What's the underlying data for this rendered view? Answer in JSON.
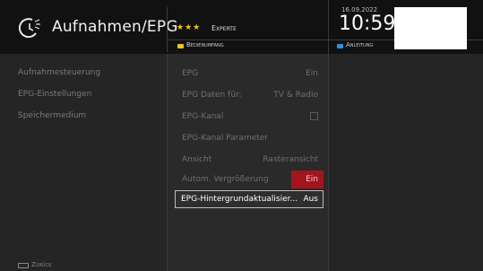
{
  "header": {
    "title": "Aufnahmen/EPG",
    "stars": "★★★",
    "level": "Experte",
    "scope_label": "Bedienumfang",
    "date": "16.09.2022",
    "time": "10:59",
    "guide_label": "Anleitung",
    "colors": {
      "yellow_key": "#f0c419",
      "blue_key": "#2e8fe0"
    }
  },
  "sidebar": {
    "items": [
      {
        "label": "Aufnahmesteuerung"
      },
      {
        "label": "EPG-Einstellungen"
      },
      {
        "label": "Speichermedium"
      }
    ]
  },
  "settings": {
    "rows": [
      {
        "label": "EPG",
        "value": "Ein"
      },
      {
        "label": "EPG Daten für:",
        "value": "TV & Radio"
      },
      {
        "label": "EPG-Kanal",
        "value": ""
      },
      {
        "label": "EPG-Kanal Parameter",
        "value": ""
      },
      {
        "label": "Ansicht",
        "value": "Rasteransicht"
      },
      {
        "label": "Autom. Vergrößerung",
        "value": "Ein"
      },
      {
        "label": "EPG-Hintergrundaktualisier...",
        "value": "Aus"
      }
    ],
    "checkbox_checked": false,
    "highlight_color": "#a3151e"
  },
  "footer": {
    "back_label": "Zurück",
    "back_icon": "back-key-icon"
  }
}
